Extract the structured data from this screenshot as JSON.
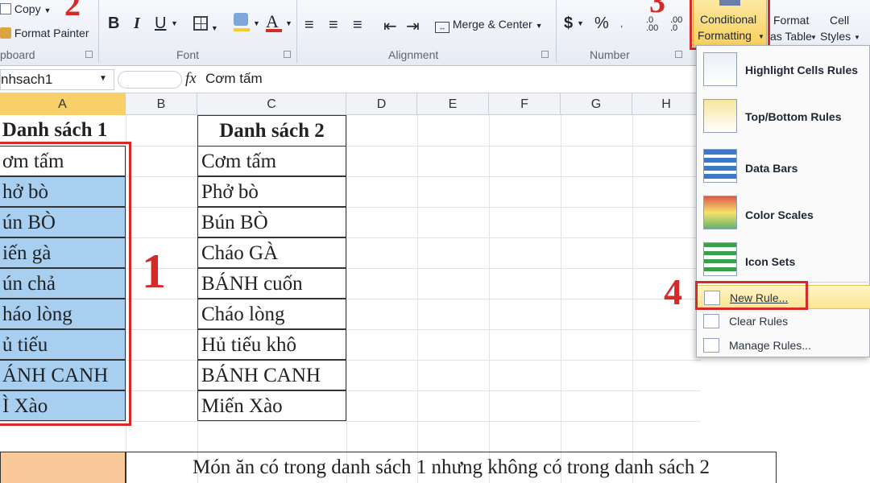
{
  "ribbon": {
    "clipboard": {
      "copy": "Copy",
      "format_painter": "Format Painter",
      "group_label": "pboard"
    },
    "font": {
      "bold": "B",
      "italic": "I",
      "underline": "U",
      "group_label": "Font"
    },
    "alignment": {
      "merge_center": "Merge & Center",
      "group_label": "Alignment"
    },
    "number": {
      "currency": "$",
      "percent": "%",
      "group_label": "Number"
    },
    "styles": {
      "conditional_line1": "Conditional",
      "conditional_line2": "Formatting",
      "format_table_line1": "Format",
      "format_table_line2": "as Table",
      "cell_styles_line1": "Cell",
      "cell_styles_line2": "Styles"
    }
  },
  "steps": {
    "two": "2",
    "three": "3",
    "one": "1",
    "four": "4"
  },
  "formula_bar": {
    "name_box": "nhsach1",
    "fx": "fx",
    "content": "Cơm tấm"
  },
  "columns": [
    "A",
    "B",
    "C",
    "D",
    "E",
    "F",
    "G",
    "H"
  ],
  "list1": {
    "header": "Danh sách 1",
    "items": [
      "ơm tấm",
      "hở bò",
      "ún BÒ",
      "iến gà",
      "ún chả",
      "háo lòng",
      "ủ tiếu",
      "ÁNH CANH",
      "Ì Xào"
    ]
  },
  "list2": {
    "header": "Danh sách 2",
    "items": [
      "Cơm tấm",
      "Phở bò",
      "Bún BÒ",
      "Cháo GÀ",
      "BÁNH cuốn",
      "Cháo lòng",
      "Hủ tiếu khô",
      "BÁNH CANH",
      "Miến Xào"
    ]
  },
  "result_label": "Món ăn có trong danh sách 1 nhưng không có trong danh sách 2",
  "menu": {
    "highlight": "Highlight Cells Rules",
    "topbottom": "Top/Bottom Rules",
    "databars": "Data Bars",
    "colorscales": "Color Scales",
    "iconsets": "Icon Sets",
    "newrule": "New Rule...",
    "clearrules": "Clear Rules",
    "managerules": "Manage Rules..."
  },
  "colors": {
    "accent_red": "#d32a2a",
    "selection_blue": "#a8cef0",
    "header_orange": "#f9c89b",
    "menu_hover": "#fce591"
  }
}
